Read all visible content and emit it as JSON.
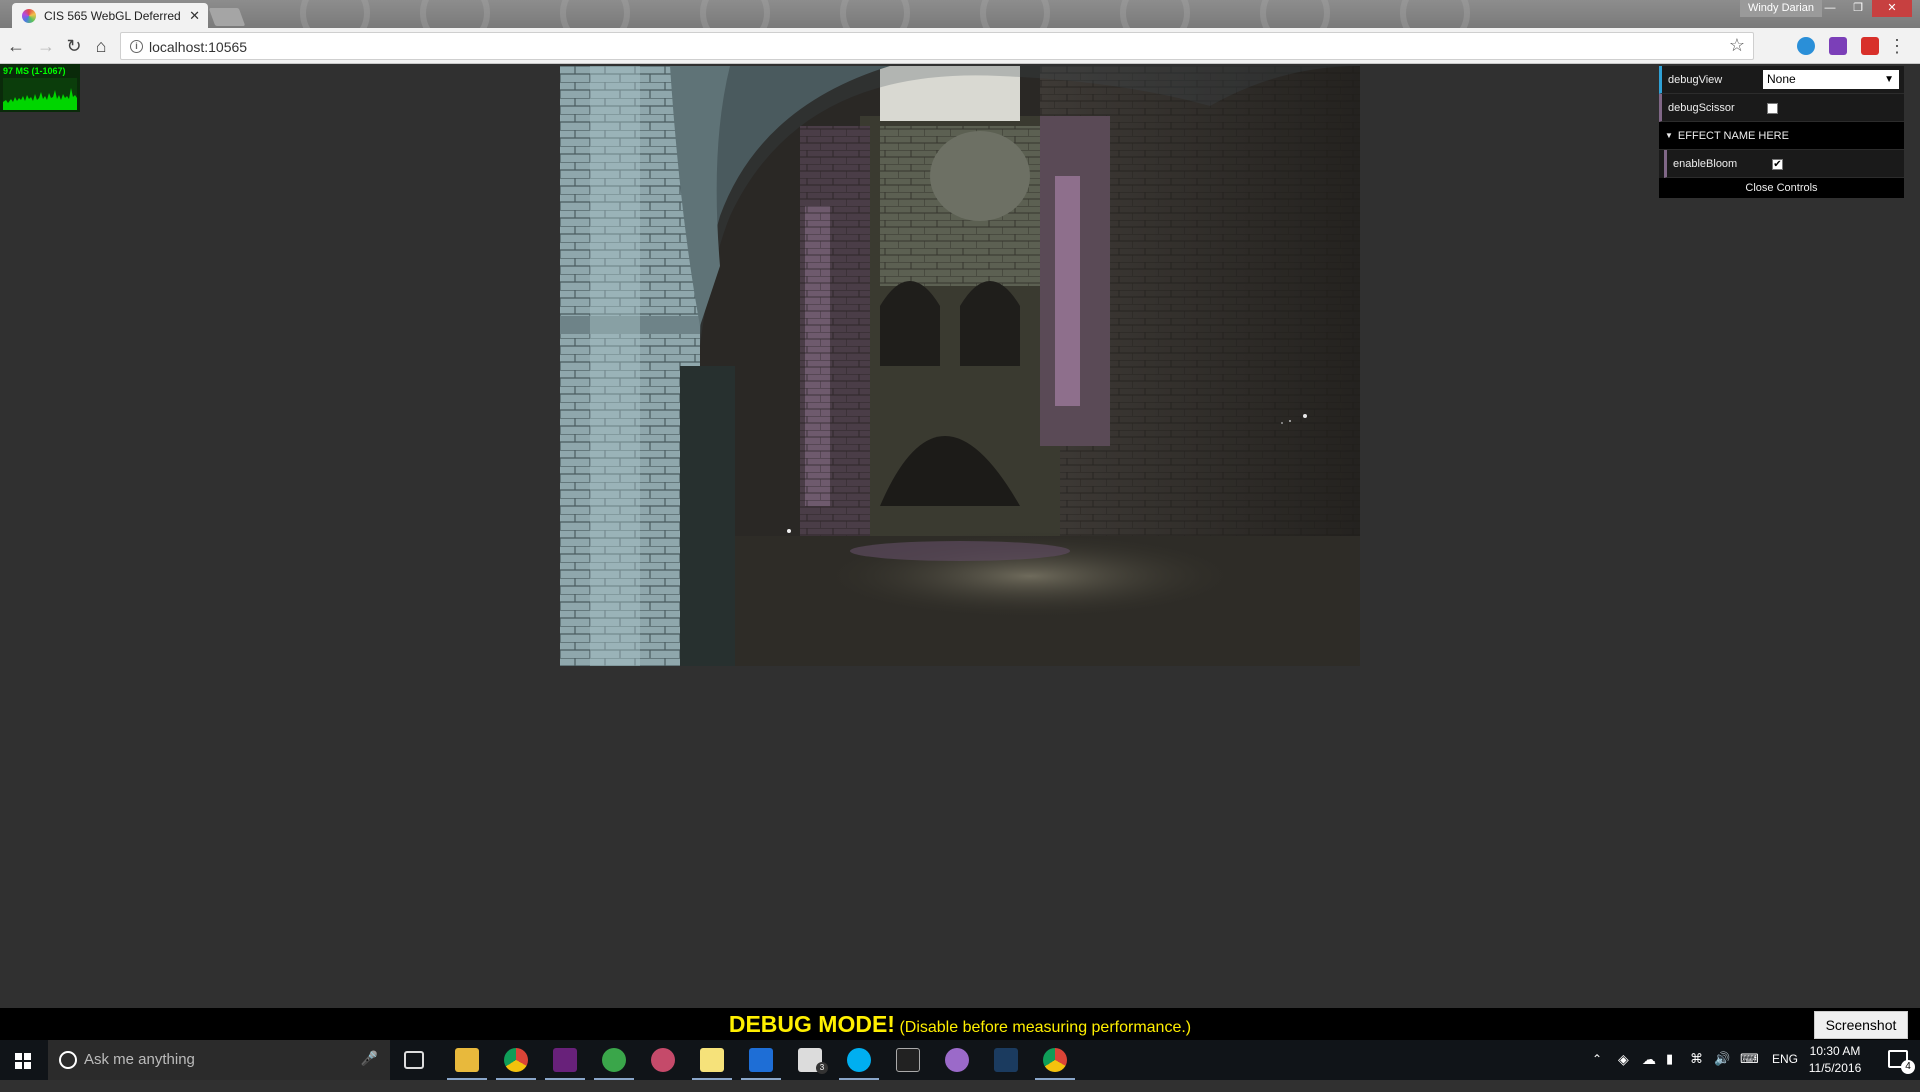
{
  "browser": {
    "tab_title": "CIS 565 WebGL Deferred",
    "tab_close": "✕",
    "user_name": "Windy Darian",
    "url": "localhost:10565"
  },
  "stats": {
    "text": "97 MS (1-1067)"
  },
  "gui": {
    "debugView_label": "debugView",
    "debugView_value": "None",
    "debugScissor_label": "debugScissor",
    "debugScissor_checked": false,
    "folder_title": "EFFECT NAME HERE",
    "enableBloom_label": "enableBloom",
    "enableBloom_checked": true,
    "close_label": "Close Controls"
  },
  "banner": {
    "main": "DEBUG MODE!",
    "sub": "(Disable before measuring performance.)",
    "screenshot_label": "Screenshot"
  },
  "taskbar": {
    "search_placeholder": "Ask me anything",
    "language": "ENG",
    "time": "10:30 AM",
    "date": "11/5/2016",
    "notification_count": "4",
    "mail_badge": "3"
  },
  "colors": {
    "gui_accent": "#2fa1d6",
    "gui_bool_accent": "#806787",
    "debug_text": "#ffef00",
    "stats_green": "#00ff00"
  }
}
